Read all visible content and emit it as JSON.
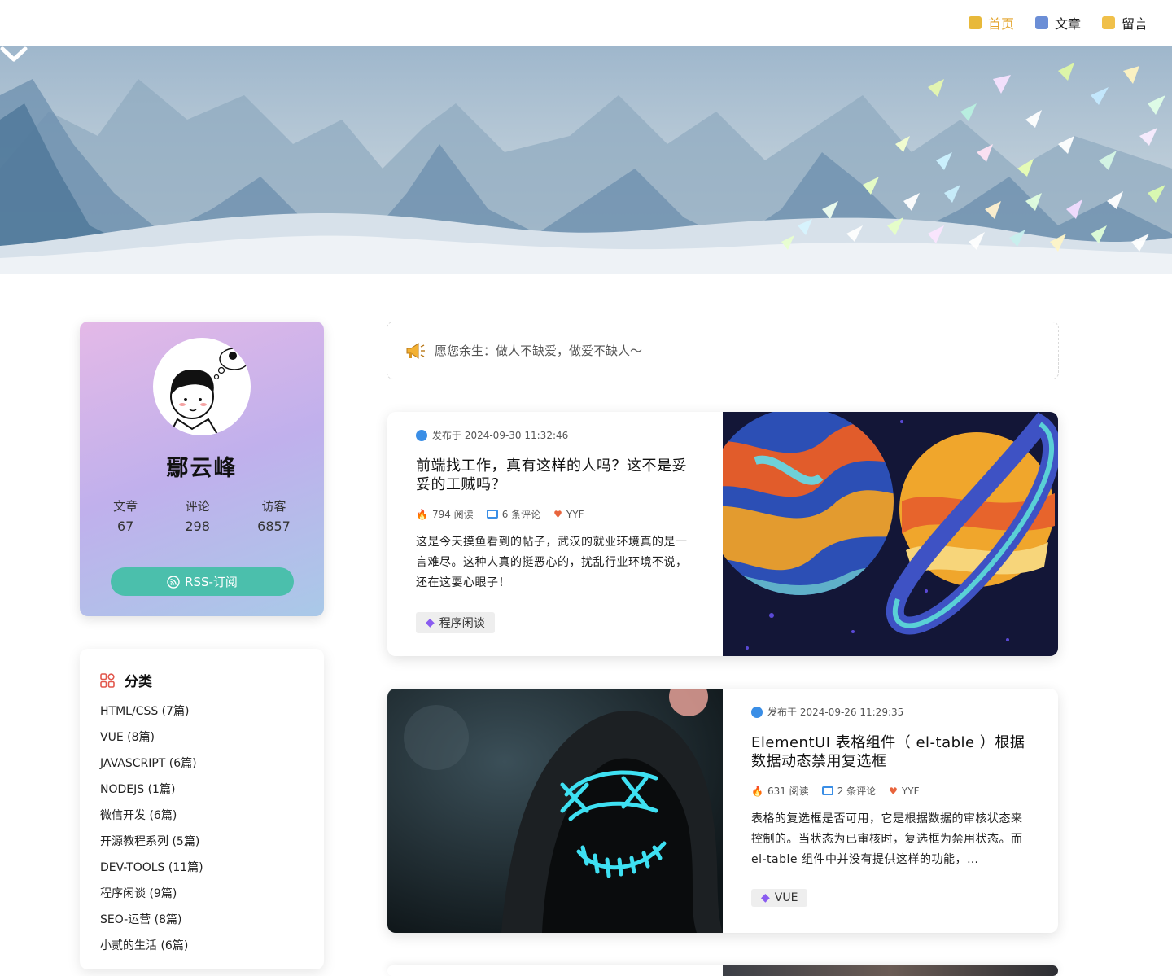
{
  "nav": {
    "items": [
      {
        "label": "首页",
        "icon": "home-icon",
        "active": true
      },
      {
        "label": "文章",
        "icon": "article-icon",
        "active": false
      },
      {
        "label": "留言",
        "icon": "message-icon",
        "active": false
      }
    ]
  },
  "profile": {
    "name": "鄢云峰",
    "stats": [
      {
        "label": "文章",
        "value": "67"
      },
      {
        "label": "评论",
        "value": "298"
      },
      {
        "label": "访客",
        "value": "6857"
      }
    ],
    "rss_label": "RSS-订阅"
  },
  "categories": {
    "title": "分类",
    "items": [
      "HTML/CSS (7篇)",
      "VUE (8篇)",
      "JAVASCRIPT (6篇)",
      "NODEJS (1篇)",
      "微信开发 (6篇)",
      "开源教程系列 (5篇)",
      "DEV-TOOLS (11篇)",
      "程序闲谈 (9篇)",
      "SEO-运营 (8篇)",
      "小贰的生活 (6篇)"
    ]
  },
  "notice": {
    "text": "愿您余生：做人不缺爱，做爱不缺人～"
  },
  "posts": [
    {
      "date": "发布于 2024-09-30 11:32:46",
      "title": "前端找工作，真有这样的人吗？这不是妥妥的工贼吗？",
      "reads": "794 阅读",
      "comments": "6 条评论",
      "author": "YYF",
      "excerpt": "这是今天摸鱼看到的帖子，武汉的就业环境真的是一言难尽。这种人真的挺恶心的，扰乱行业环境不说，还在这耍心眼子！",
      "tag": "程序闲谈"
    },
    {
      "date": "发布于 2024-09-26 11:29:35",
      "title": "ElementUI 表格组件（ el-table ）根据数据动态禁用复选框",
      "reads": "631 阅读",
      "comments": "2 条评论",
      "author": "YYF",
      "excerpt": "表格的复选框是否可用，它是根据数据的审核状态来控制的。当状态为已审核时，复选框为禁用状态。而 el-table 组件中并没有提供这样的功能，…",
      "tag": "VUE"
    }
  ],
  "colors": {
    "accent": "#e3a32a",
    "rss": "#4bbfac",
    "link": "#3a8ee6"
  }
}
